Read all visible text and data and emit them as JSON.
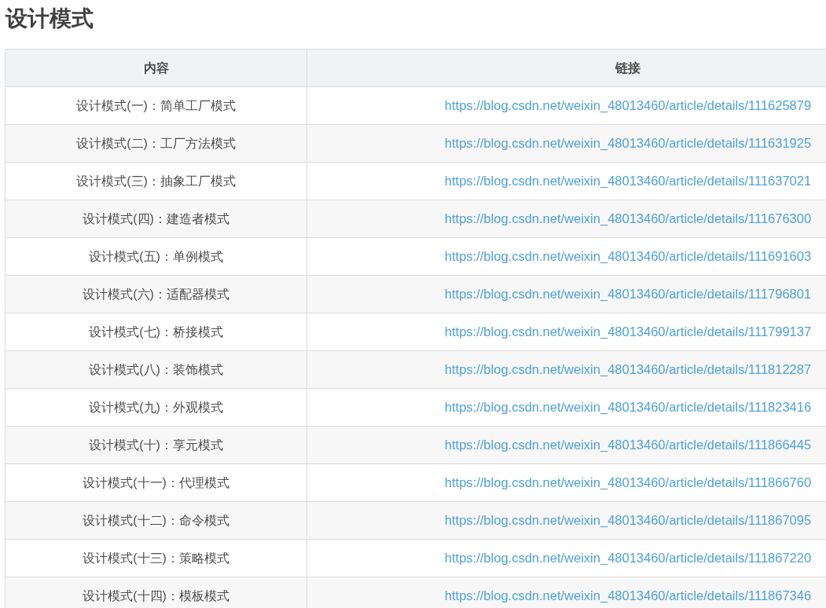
{
  "title": "设计模式",
  "table": {
    "columns": [
      "内容",
      "链接"
    ],
    "rows": [
      {
        "content": "设计模式(一)：简单工厂模式",
        "link": "https://blog.csdn.net/weixin_48013460/article/details/111625879"
      },
      {
        "content": "设计模式(二)：工厂方法模式",
        "link": "https://blog.csdn.net/weixin_48013460/article/details/111631925"
      },
      {
        "content": "设计模式(三)：抽象工厂模式",
        "link": "https://blog.csdn.net/weixin_48013460/article/details/111637021"
      },
      {
        "content": "设计模式(四)：建造者模式",
        "link": "https://blog.csdn.net/weixin_48013460/article/details/111676300"
      },
      {
        "content": "设计模式(五)：单例模式",
        "link": "https://blog.csdn.net/weixin_48013460/article/details/111691603"
      },
      {
        "content": "设计模式(六)：适配器模式",
        "link": "https://blog.csdn.net/weixin_48013460/article/details/111796801"
      },
      {
        "content": "设计模式(七)：桥接模式",
        "link": "https://blog.csdn.net/weixin_48013460/article/details/111799137"
      },
      {
        "content": "设计模式(八)：装饰模式",
        "link": "https://blog.csdn.net/weixin_48013460/article/details/111812287"
      },
      {
        "content": "设计模式(九)：外观模式",
        "link": "https://blog.csdn.net/weixin_48013460/article/details/111823416"
      },
      {
        "content": "设计模式(十)：享元模式",
        "link": "https://blog.csdn.net/weixin_48013460/article/details/111866445"
      },
      {
        "content": "设计模式(十一)：代理模式",
        "link": "https://blog.csdn.net/weixin_48013460/article/details/111866760"
      },
      {
        "content": "设计模式(十二)：命令模式",
        "link": "https://blog.csdn.net/weixin_48013460/article/details/111867095"
      },
      {
        "content": "设计模式(十三)：策略模式",
        "link": "https://blog.csdn.net/weixin_48013460/article/details/111867220"
      },
      {
        "content": "设计模式(十四)：模板模式",
        "link": "https://blog.csdn.net/weixin_48013460/article/details/111867346"
      }
    ]
  }
}
